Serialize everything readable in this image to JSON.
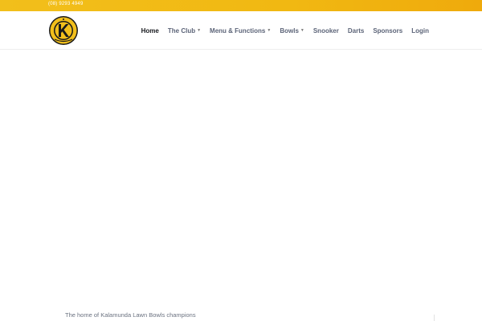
{
  "topbar": {
    "phone": "(08) 9293 4949",
    "color": "#f2bf1b"
  },
  "header": {
    "logo": {
      "icon": "kalamunda-club-crest-icon",
      "colors": [
        "#f2bf1b",
        "#1a1a1a"
      ]
    },
    "nav": {
      "home": "Home",
      "club": "The Club",
      "menu": "Menu & Functions",
      "bowls": "Bowls",
      "snooker": "Snooker",
      "darts": "Darts",
      "sponsors": "Sponsors",
      "login": "Login"
    },
    "dropdown_icon": "caret-down-icon"
  },
  "hero": {
    "tagline": "The home of Kalamunda Lawn Bowls champions"
  }
}
